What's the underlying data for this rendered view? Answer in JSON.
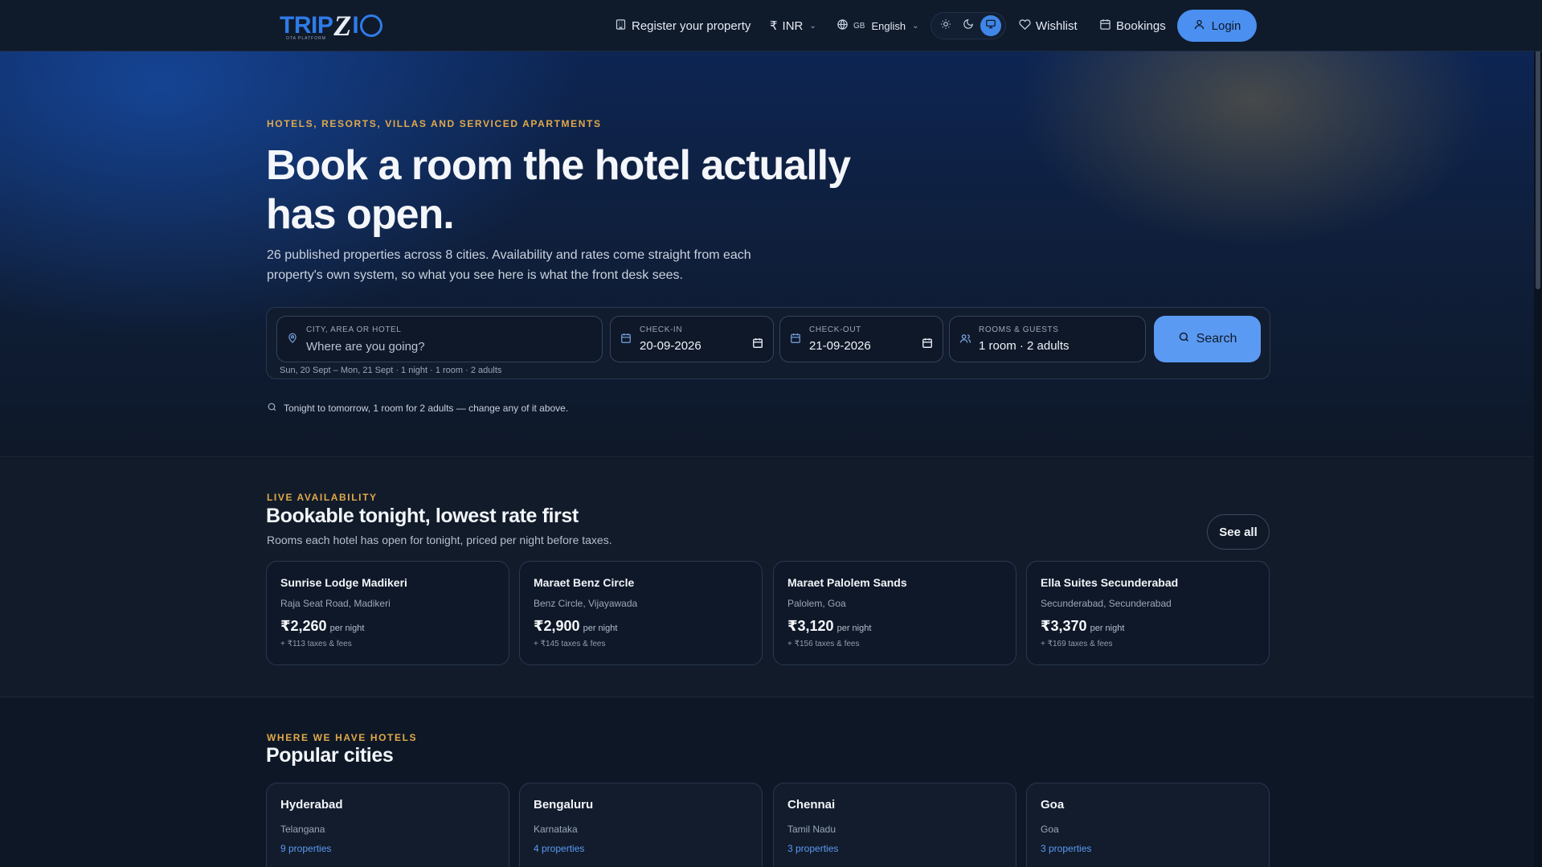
{
  "brand": {
    "logo_text": "TRIPZIO",
    "logo_tagline": "OTA PLATFORM"
  },
  "header": {
    "register_label": "Register your property",
    "currency_symbol": "₹",
    "currency_label": "INR",
    "lang_flag": "GB",
    "lang_label": "English",
    "theme_options": [
      "light-icon",
      "dark-icon",
      "system-icon"
    ],
    "theme_selected": "system",
    "wishlist_label": "Wishlist",
    "bookings_label": "Bookings",
    "login_label": "Login"
  },
  "hero": {
    "eyebrow": "HOTELS, RESORTS, VILLAS AND SERVICED APARTMENTS",
    "title": "Book a room the hotel actually has open.",
    "subtitle": "26 published properties across 8 cities. Availability and rates come straight from each property's own system, so what you see here is what the front desk sees.",
    "search": {
      "destination_label": "CITY, AREA OR HOTEL",
      "destination_placeholder": "Where are you going?",
      "checkin_label": "CHECK-IN",
      "checkin_value": "20-09-2026",
      "checkout_label": "CHECK-OUT",
      "checkout_value": "21-09-2026",
      "guests_label": "ROOMS & GUESTS",
      "guests_value": "1 room · 2 adults",
      "button_label": "Search",
      "summary": "Sun, 20 Sept – Mon, 21 Sept · 1 night · 1 room · 2 adults"
    },
    "hint": "Tonight to tomorrow, 1 room for 2 adults — change any of it above."
  },
  "live": {
    "eyebrow": "LIVE AVAILABILITY",
    "title": "Bookable tonight, lowest rate first",
    "subtitle": "Rooms each hotel has open for tonight, priced per night before taxes.",
    "see_all_label": "See all",
    "hotels": [
      {
        "name": "Sunrise Lodge Madikeri",
        "address": "Raja Seat Road, Madikeri",
        "price": "₹2,260",
        "per": "per night",
        "taxes": "+ ₹113 taxes & fees"
      },
      {
        "name": "Maraet Benz Circle",
        "address": "Benz Circle, Vijayawada",
        "price": "₹2,900",
        "per": "per night",
        "taxes": "+ ₹145 taxes & fees"
      },
      {
        "name": "Maraet Palolem Sands",
        "address": "Palolem, Goa",
        "price": "₹3,120",
        "per": "per night",
        "taxes": "+ ₹156 taxes & fees"
      },
      {
        "name": "Ella Suites Secunderabad",
        "address": "Secunderabad, Secunderabad",
        "price": "₹3,370",
        "per": "per night",
        "taxes": "+ ₹169 taxes & fees"
      }
    ]
  },
  "cities": {
    "eyebrow": "WHERE WE HAVE HOTELS",
    "title": "Popular cities",
    "items": [
      {
        "name": "Hyderabad",
        "state": "Telangana",
        "count": "9 properties"
      },
      {
        "name": "Bengaluru",
        "state": "Karnataka",
        "count": "4 properties"
      },
      {
        "name": "Chennai",
        "state": "Tamil Nadu",
        "count": "3 properties"
      },
      {
        "name": "Goa",
        "state": "Goa",
        "count": "3 properties"
      }
    ]
  },
  "colors": {
    "accent": "#4b8ff0",
    "eyebrow": "#e1a94a",
    "background": "#0e1726"
  }
}
